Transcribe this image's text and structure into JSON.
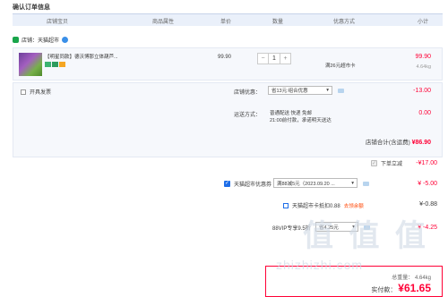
{
  "page_title": "确认订单信息",
  "table_headers": [
    "店铺宝贝",
    "商品属性",
    "单价",
    "数量",
    "优惠方式",
    "小计"
  ],
  "shop": {
    "label": "店铺：天猫超市"
  },
  "item": {
    "name": "【明星同款】德沃博那立体葫芦...",
    "unit_price": "99.90",
    "quantity": "1",
    "qty_minus": "−",
    "qty_plus": "+",
    "promo": "满26元超市卡",
    "subtotal": "99.90",
    "weight": "4.64kg"
  },
  "options": {
    "invoice_label": "开具发票",
    "store_discount_label": "店铺优惠：",
    "store_discount_select": "省13元:组合优惠",
    "store_discount_value": "-13.00",
    "shipping_label": "运送方式：",
    "shipping_line1": "普通配送 快递 免邮",
    "shipping_line2": "21:00前付款，承诺明天送达",
    "shipping_value": "0.00",
    "store_total_label": "店铺合计(含运费)",
    "store_total_value": "¥86.90"
  },
  "order_discount": {
    "label": "下单立减",
    "value": "-¥17.00"
  },
  "coupon": {
    "label": "天猫超市优惠券",
    "select": "满88减5元（2023.09.20 ...",
    "value": "¥ -5.00"
  },
  "card": {
    "label": "天猫超市卡抵扣0.88",
    "link": "去领余额",
    "value": "¥-0.88"
  },
  "vip": {
    "label": "88VIP专享9.5折",
    "select": "省4.25元",
    "value": "¥ -4.25"
  },
  "summary": {
    "weight_label": "总重量：",
    "weight": "4.64kg",
    "pay_label": "实付款：",
    "currency": "¥",
    "amount": "61.65"
  },
  "watermark": {
    "big": "值 值 值",
    "url": "zhizhizhi.com"
  },
  "colors": {
    "accent": "#ff0036",
    "header_bg": "#eaf0fa",
    "brand_blue": "#1e6ee8"
  }
}
